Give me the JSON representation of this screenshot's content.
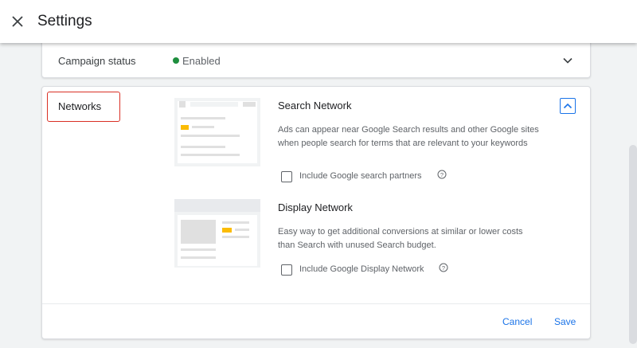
{
  "header": {
    "title": "Settings",
    "close_icon": "close-icon"
  },
  "campaign_status": {
    "label": "Campaign status",
    "value": "Enabled",
    "status_color": "#1e8e3e"
  },
  "networks": {
    "section_label": "Networks",
    "search": {
      "title": "Search Network",
      "description": "Ads can appear near Google Search results and other Google sites when people search for terms that are relevant to your keywords",
      "checkbox_label": "Include Google search partners",
      "checked": false
    },
    "display": {
      "title": "Display Network",
      "description": "Easy way to get additional conversions at similar or lower costs than Search with unused Search budget.",
      "checkbox_label": "Include Google Display Network",
      "checked": false
    }
  },
  "actions": {
    "cancel": "Cancel",
    "save": "Save"
  },
  "colors": {
    "accent": "#1a73e8",
    "highlight_border": "#d93025",
    "illustration_accent": "#fbbc04"
  }
}
